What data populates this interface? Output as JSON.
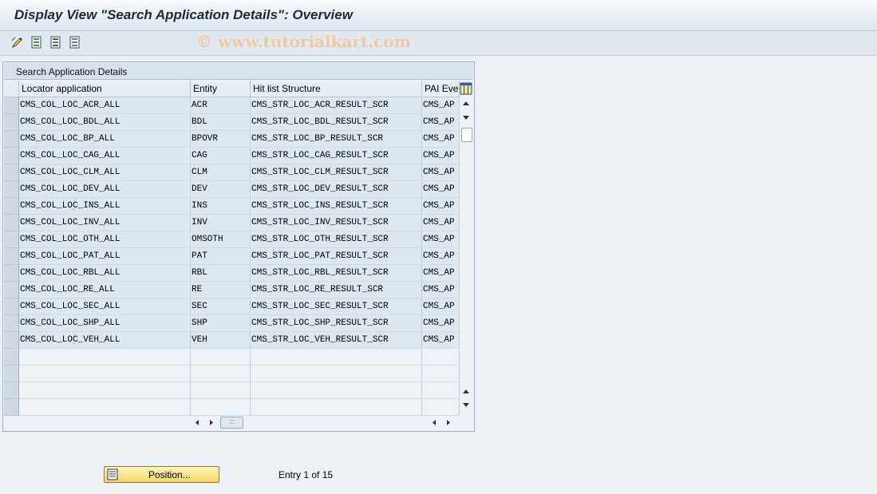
{
  "title": "Display View \"Search Application Details\": Overview",
  "watermark": "© www.tutorialkart.com",
  "toolbar": {
    "icons": [
      "change-icon",
      "select-all-icon",
      "select-block-icon",
      "deselect-all-icon"
    ]
  },
  "panel": {
    "title": "Search Application Details",
    "columns": [
      "Locator application",
      "Entity",
      "Hit list Structure",
      "PAI Eve"
    ],
    "rows": [
      [
        "CMS_COL_LOC_ACR_ALL",
        "ACR",
        "CMS_STR_LOC_ACR_RESULT_SCR",
        "CMS_AP"
      ],
      [
        "CMS_COL_LOC_BDL_ALL",
        "BDL",
        "CMS_STR_LOC_BDL_RESULT_SCR",
        "CMS_AP"
      ],
      [
        "CMS_COL_LOC_BP_ALL",
        "BPOVR",
        "CMS_STR_LOC_BP_RESULT_SCR",
        "CMS_AP"
      ],
      [
        "CMS_COL_LOC_CAG_ALL",
        "CAG",
        "CMS_STR_LOC_CAG_RESULT_SCR",
        "CMS_AP"
      ],
      [
        "CMS_COL_LOC_CLM_ALL",
        "CLM",
        "CMS_STR_LOC_CLM_RESULT_SCR",
        "CMS_AP"
      ],
      [
        "CMS_COL_LOC_DEV_ALL",
        "DEV",
        "CMS_STR_LOC_DEV_RESULT_SCR",
        "CMS_AP"
      ],
      [
        "CMS_COL_LOC_INS_ALL",
        "INS",
        "CMS_STR_LOC_INS_RESULT_SCR",
        "CMS_AP"
      ],
      [
        "CMS_COL_LOC_INV_ALL",
        "INV",
        "CMS_STR_LOC_INV_RESULT_SCR",
        "CMS_AP"
      ],
      [
        "CMS_COL_LOC_OTH_ALL",
        "OMSOTH",
        "CMS_STR_LOC_OTH_RESULT_SCR",
        "CMS_AP"
      ],
      [
        "CMS_COL_LOC_PAT_ALL",
        "PAT",
        "CMS_STR_LOC_PAT_RESULT_SCR",
        "CMS_AP"
      ],
      [
        "CMS_COL_LOC_RBL_ALL",
        "RBL",
        "CMS_STR_LOC_RBL_RESULT_SCR",
        "CMS_AP"
      ],
      [
        "CMS_COL_LOC_RE_ALL",
        "RE",
        "CMS_STR_LOC_RE_RESULT_SCR",
        "CMS_AP"
      ],
      [
        "CMS_COL_LOC_SEC_ALL",
        "SEC",
        "CMS_STR_LOC_SEC_RESULT_SCR",
        "CMS_AP"
      ],
      [
        "CMS_COL_LOC_SHP_ALL",
        "SHP",
        "CMS_STR_LOC_SHP_RESULT_SCR",
        "CMS_AP"
      ],
      [
        "CMS_COL_LOC_VEH_ALL",
        "VEH",
        "CMS_STR_LOC_VEH_RESULT_SCR",
        "CMS_AP"
      ],
      [
        "",
        "",
        "",
        ""
      ],
      [
        "",
        "",
        "",
        ""
      ],
      [
        "",
        "",
        "",
        ""
      ],
      [
        "",
        "",
        "",
        ""
      ]
    ]
  },
  "footer": {
    "position_button": "Position...",
    "entry_text": "Entry 1 of 15"
  },
  "colors": {
    "background": "#edf1f5",
    "cell": "#dde7f0",
    "button": "#f3d66a"
  }
}
